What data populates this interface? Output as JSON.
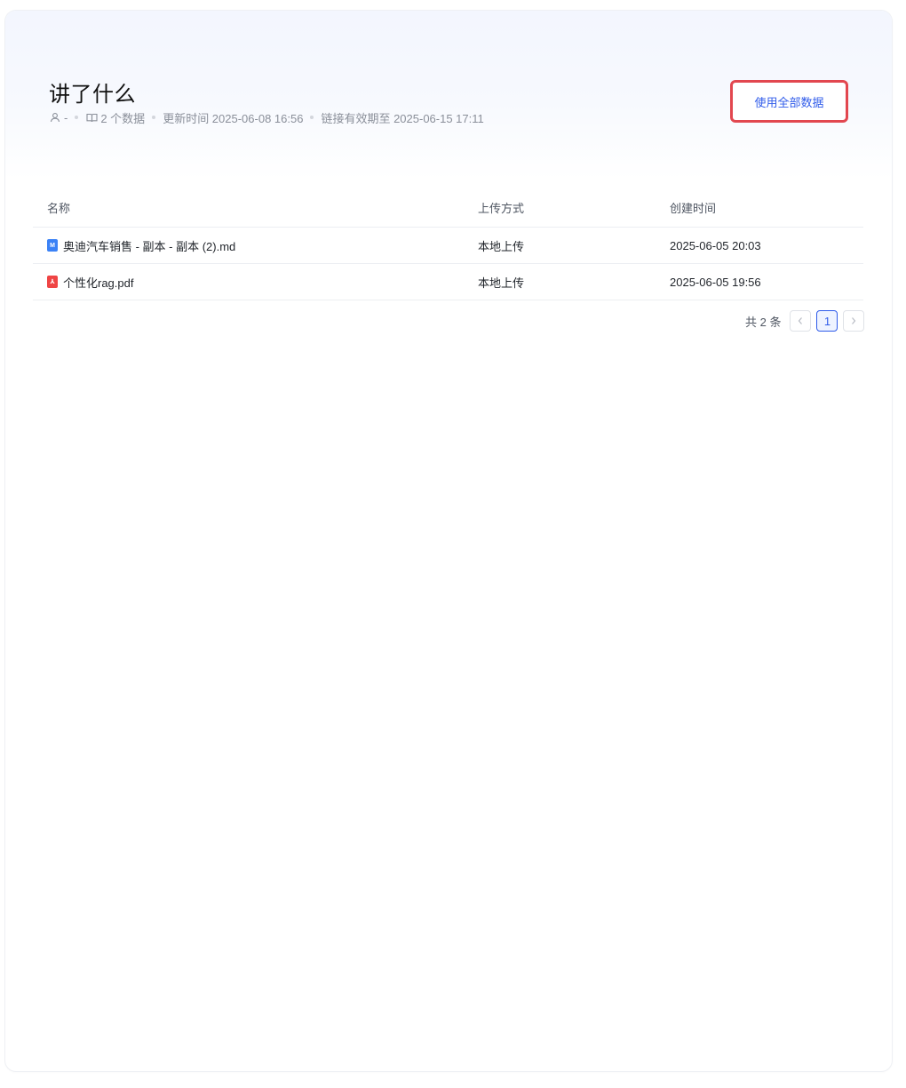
{
  "header": {
    "title": "讲了什么",
    "owner": "-",
    "data_count": "2 个数据",
    "updated": "更新时间 2025-06-08 16:56",
    "link_expiry": "链接有效期至 2025-06-15 17:11",
    "use_all_label": "使用全部数据"
  },
  "table": {
    "columns": [
      "名称",
      "上传方式",
      "创建时间"
    ],
    "rows": [
      {
        "icon": "markdown-file-icon",
        "icon_glyph": "M",
        "name": "奥迪汽车销售 - 副本 - 副本 (2).md",
        "method": "本地上传",
        "created": "2025-06-05 20:03"
      },
      {
        "icon": "pdf-file-icon",
        "icon_glyph": "⅄",
        "name": "个性化rag.pdf",
        "method": "本地上传",
        "created": "2025-06-05 19:56"
      }
    ]
  },
  "pagination": {
    "total": "共 2 条",
    "current": "1"
  },
  "colors": {
    "accent": "#2f5bea",
    "highlight_border": "#e2474f",
    "md_icon": "#3b82f6",
    "pdf_icon": "#ef4444"
  }
}
